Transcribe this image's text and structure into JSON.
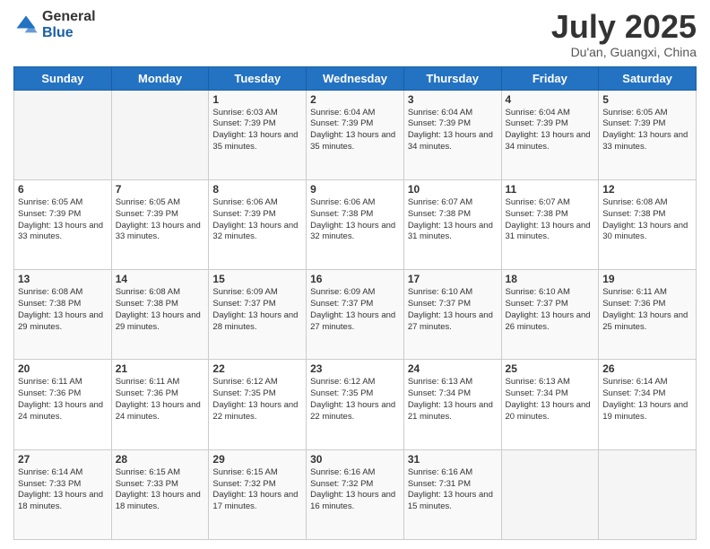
{
  "header": {
    "logo_general": "General",
    "logo_blue": "Blue",
    "month_title": "July 2025",
    "location": "Du'an, Guangxi, China"
  },
  "weekdays": [
    "Sunday",
    "Monday",
    "Tuesday",
    "Wednesday",
    "Thursday",
    "Friday",
    "Saturday"
  ],
  "weeks": [
    [
      {
        "day": "",
        "content": ""
      },
      {
        "day": "",
        "content": ""
      },
      {
        "day": "1",
        "content": "Sunrise: 6:03 AM\nSunset: 7:39 PM\nDaylight: 13 hours and 35 minutes."
      },
      {
        "day": "2",
        "content": "Sunrise: 6:04 AM\nSunset: 7:39 PM\nDaylight: 13 hours and 35 minutes."
      },
      {
        "day": "3",
        "content": "Sunrise: 6:04 AM\nSunset: 7:39 PM\nDaylight: 13 hours and 34 minutes."
      },
      {
        "day": "4",
        "content": "Sunrise: 6:04 AM\nSunset: 7:39 PM\nDaylight: 13 hours and 34 minutes."
      },
      {
        "day": "5",
        "content": "Sunrise: 6:05 AM\nSunset: 7:39 PM\nDaylight: 13 hours and 33 minutes."
      }
    ],
    [
      {
        "day": "6",
        "content": "Sunrise: 6:05 AM\nSunset: 7:39 PM\nDaylight: 13 hours and 33 minutes."
      },
      {
        "day": "7",
        "content": "Sunrise: 6:05 AM\nSunset: 7:39 PM\nDaylight: 13 hours and 33 minutes."
      },
      {
        "day": "8",
        "content": "Sunrise: 6:06 AM\nSunset: 7:39 PM\nDaylight: 13 hours and 32 minutes."
      },
      {
        "day": "9",
        "content": "Sunrise: 6:06 AM\nSunset: 7:38 PM\nDaylight: 13 hours and 32 minutes."
      },
      {
        "day": "10",
        "content": "Sunrise: 6:07 AM\nSunset: 7:38 PM\nDaylight: 13 hours and 31 minutes."
      },
      {
        "day": "11",
        "content": "Sunrise: 6:07 AM\nSunset: 7:38 PM\nDaylight: 13 hours and 31 minutes."
      },
      {
        "day": "12",
        "content": "Sunrise: 6:08 AM\nSunset: 7:38 PM\nDaylight: 13 hours and 30 minutes."
      }
    ],
    [
      {
        "day": "13",
        "content": "Sunrise: 6:08 AM\nSunset: 7:38 PM\nDaylight: 13 hours and 29 minutes."
      },
      {
        "day": "14",
        "content": "Sunrise: 6:08 AM\nSunset: 7:38 PM\nDaylight: 13 hours and 29 minutes."
      },
      {
        "day": "15",
        "content": "Sunrise: 6:09 AM\nSunset: 7:37 PM\nDaylight: 13 hours and 28 minutes."
      },
      {
        "day": "16",
        "content": "Sunrise: 6:09 AM\nSunset: 7:37 PM\nDaylight: 13 hours and 27 minutes."
      },
      {
        "day": "17",
        "content": "Sunrise: 6:10 AM\nSunset: 7:37 PM\nDaylight: 13 hours and 27 minutes."
      },
      {
        "day": "18",
        "content": "Sunrise: 6:10 AM\nSunset: 7:37 PM\nDaylight: 13 hours and 26 minutes."
      },
      {
        "day": "19",
        "content": "Sunrise: 6:11 AM\nSunset: 7:36 PM\nDaylight: 13 hours and 25 minutes."
      }
    ],
    [
      {
        "day": "20",
        "content": "Sunrise: 6:11 AM\nSunset: 7:36 PM\nDaylight: 13 hours and 24 minutes."
      },
      {
        "day": "21",
        "content": "Sunrise: 6:11 AM\nSunset: 7:36 PM\nDaylight: 13 hours and 24 minutes."
      },
      {
        "day": "22",
        "content": "Sunrise: 6:12 AM\nSunset: 7:35 PM\nDaylight: 13 hours and 22 minutes."
      },
      {
        "day": "23",
        "content": "Sunrise: 6:12 AM\nSunset: 7:35 PM\nDaylight: 13 hours and 22 minutes."
      },
      {
        "day": "24",
        "content": "Sunrise: 6:13 AM\nSunset: 7:34 PM\nDaylight: 13 hours and 21 minutes."
      },
      {
        "day": "25",
        "content": "Sunrise: 6:13 AM\nSunset: 7:34 PM\nDaylight: 13 hours and 20 minutes."
      },
      {
        "day": "26",
        "content": "Sunrise: 6:14 AM\nSunset: 7:34 PM\nDaylight: 13 hours and 19 minutes."
      }
    ],
    [
      {
        "day": "27",
        "content": "Sunrise: 6:14 AM\nSunset: 7:33 PM\nDaylight: 13 hours and 18 minutes."
      },
      {
        "day": "28",
        "content": "Sunrise: 6:15 AM\nSunset: 7:33 PM\nDaylight: 13 hours and 18 minutes."
      },
      {
        "day": "29",
        "content": "Sunrise: 6:15 AM\nSunset: 7:32 PM\nDaylight: 13 hours and 17 minutes."
      },
      {
        "day": "30",
        "content": "Sunrise: 6:16 AM\nSunset: 7:32 PM\nDaylight: 13 hours and 16 minutes."
      },
      {
        "day": "31",
        "content": "Sunrise: 6:16 AM\nSunset: 7:31 PM\nDaylight: 13 hours and 15 minutes."
      },
      {
        "day": "",
        "content": ""
      },
      {
        "day": "",
        "content": ""
      }
    ]
  ]
}
